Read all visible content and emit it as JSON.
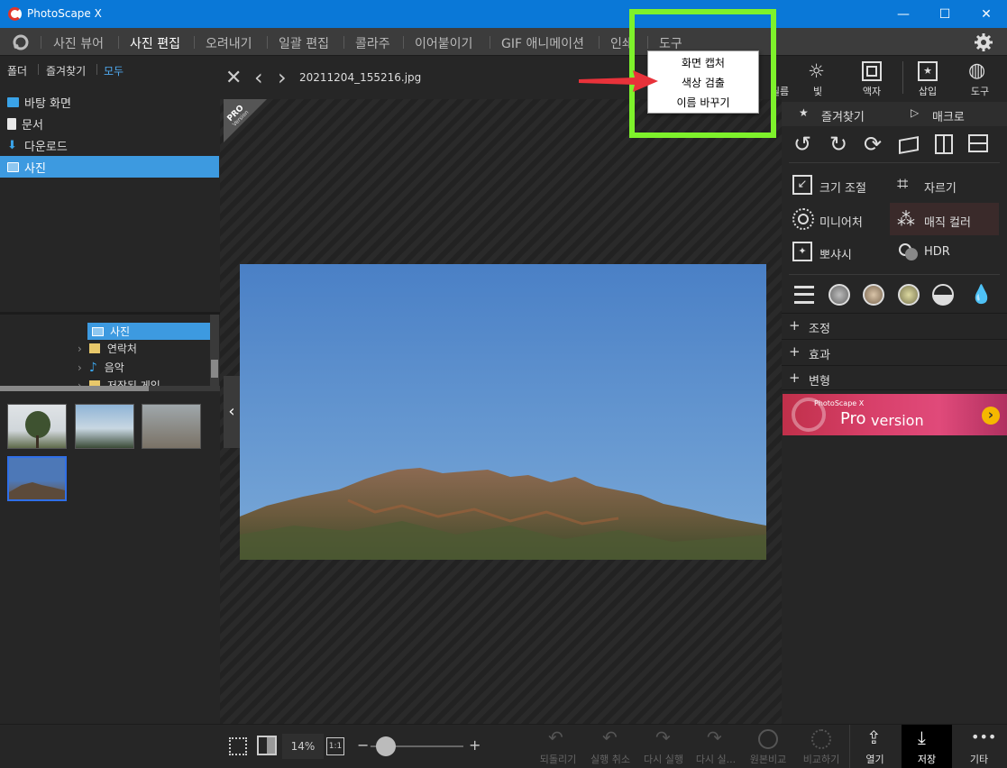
{
  "app": {
    "title": "PhotoScape X"
  },
  "window": {
    "minimize": "—",
    "maximize": "☐",
    "close": "✕"
  },
  "menu": {
    "items": [
      "사진 뷰어",
      "사진 편집",
      "오려내기",
      "일괄 편집",
      "콜라주",
      "이어붙이기",
      "GIF 애니메이션",
      "인쇄",
      "도구"
    ]
  },
  "left": {
    "tabs": [
      "폴더",
      "즐겨찾기",
      "모두"
    ],
    "tree": [
      "바탕 화면",
      "문서",
      "다운로드",
      "사진"
    ],
    "tree2": [
      "사진",
      "연락처",
      "음악",
      "저장된 게임"
    ]
  },
  "viewer": {
    "filename": "20211204_155216.jpg",
    "pro_badge": "PRO",
    "pro_badge_sub": "Version"
  },
  "dropdown": {
    "items": [
      "화면 캡처",
      "색상 검출",
      "이름 바꾸기"
    ]
  },
  "right": {
    "top_icons": [
      "필름",
      "빛",
      "액자",
      "삽입",
      "도구"
    ],
    "favorites": "즐겨찾기",
    "macro": "매크로",
    "tools": [
      "크기 조절",
      "자르기",
      "미니어처",
      "매직 컬러",
      "뽀샤시",
      "HDR"
    ],
    "sections": [
      "조정",
      "효과",
      "변형"
    ],
    "banner_small": "PhotoScape X",
    "banner_big": "Pro",
    "banner_rest": "version"
  },
  "bottom": {
    "zoom": "14%",
    "ratio": "1:1",
    "actions": [
      "되돌리기",
      "실행 취소",
      "다시 실행",
      "다시 실...",
      "원본비교",
      "비교하기"
    ],
    "open": "열기",
    "save": "저장",
    "more": "기타"
  },
  "colors": {
    "titlebar": "#0a78d7",
    "selection": "#3d9ae0",
    "highlight": "#7ef22b",
    "arrow": "#e8323a"
  }
}
